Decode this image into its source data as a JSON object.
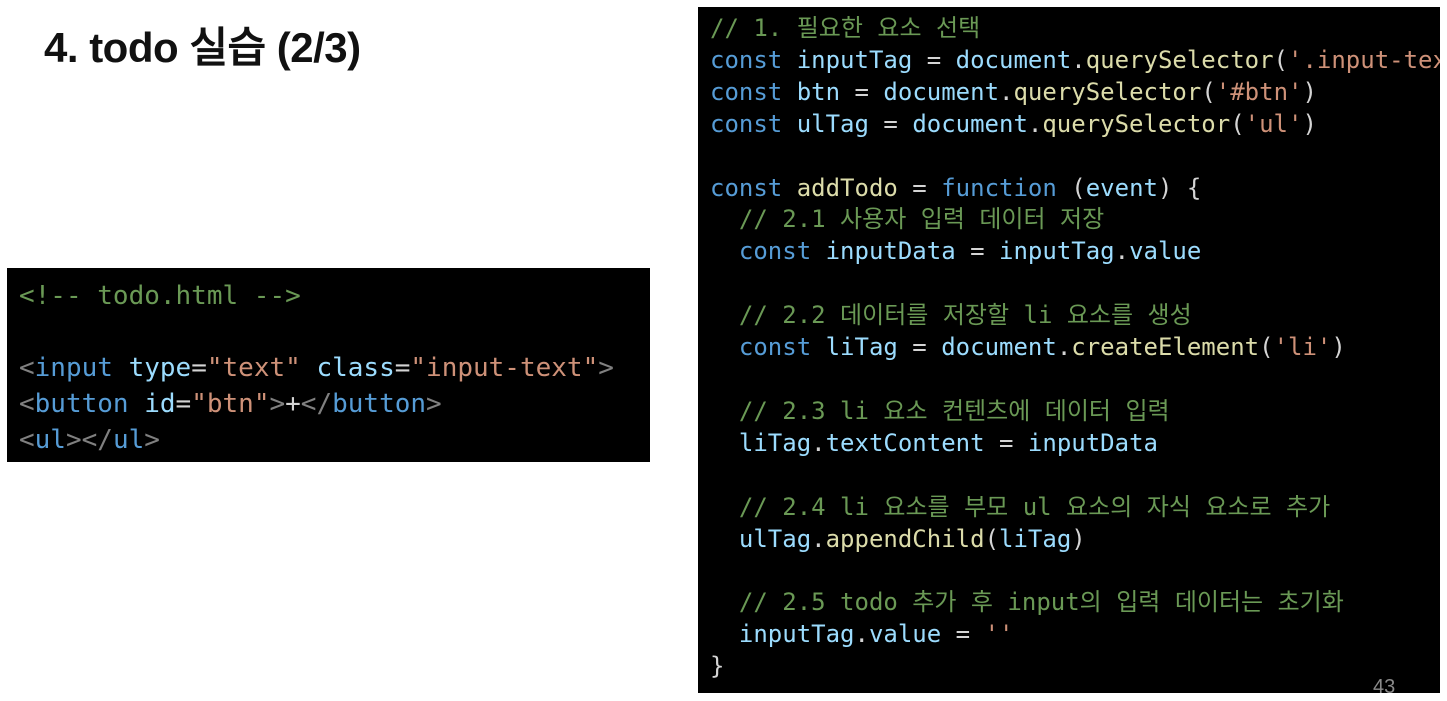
{
  "slide": {
    "title": "4. todo 실습 (2/3)",
    "page_number": "43"
  },
  "html_code": {
    "comment": "<!-- todo.html -->",
    "line1": {
      "tag": "input",
      "attr1": "type",
      "val1": "\"text\"",
      "attr2": "class",
      "val2": "\"input-text\""
    },
    "line2": {
      "tag": "button",
      "attr": "id",
      "val": "\"btn\"",
      "text": "+"
    },
    "line3": {
      "tag": "ul"
    }
  },
  "js_code": {
    "c1": "// 1. 필요한 요소 선택",
    "sel1": {
      "name": "inputTag",
      "arg": "'.input-text'"
    },
    "sel2": {
      "name": "btn",
      "arg": "'#btn'"
    },
    "sel3": {
      "name": "ulTag",
      "arg": "'ul'"
    },
    "fn_name": "addTodo",
    "fn_param": "event",
    "c21": "// 2.1 사용자 입력 데이터 저장",
    "input_data_var": "inputData",
    "c22": "// 2.2 데이터를 저장할 li 요소를 생성",
    "li_var": "liTag",
    "li_arg": "'li'",
    "c23": "// 2.3 li 요소 컨텐츠에 데이터 입력",
    "c24": "// 2.4 li 요소를 부모 ul 요소의 자식 요소로 추가",
    "c25": "// 2.5 todo 추가 후 input의 입력 데이터는 초기화",
    "empty_str": "''"
  }
}
